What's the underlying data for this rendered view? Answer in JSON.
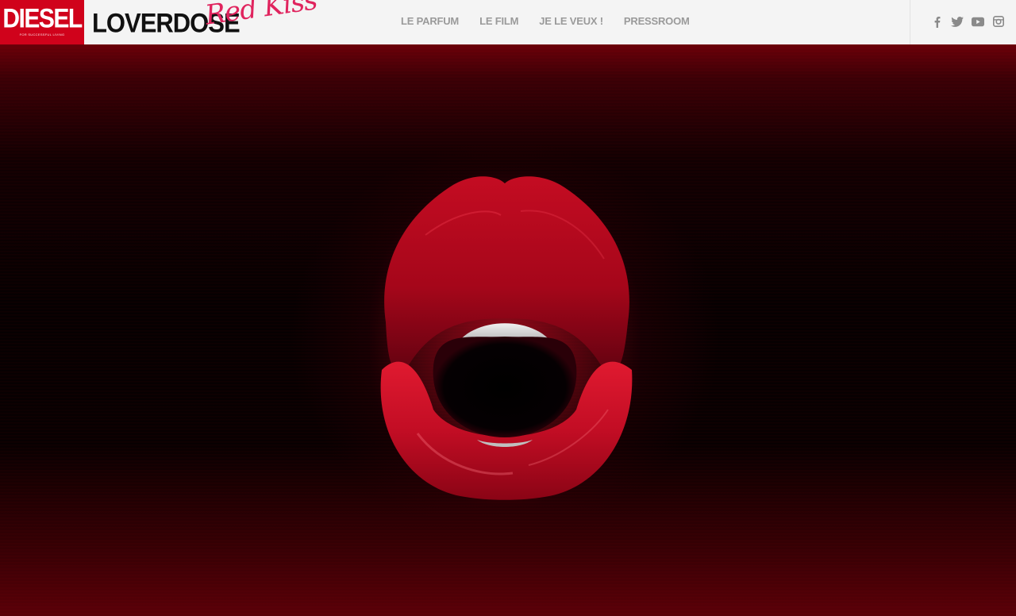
{
  "brand": {
    "diesel": "DIESEL",
    "diesel_tagline": "FOR SUCCESSFUL LIVING",
    "loverdose": "LOVERDOSE",
    "redkiss": "Red Kiss",
    "accent_red": "#d0021b",
    "accent_pink": "#e0245e"
  },
  "nav": {
    "items": [
      {
        "label": "LE PARFUM"
      },
      {
        "label": "LE FILM"
      },
      {
        "label": "JE LE VEUX !"
      },
      {
        "label": "PRESSROOM"
      }
    ]
  },
  "social": {
    "icons": [
      "facebook-icon",
      "twitter-icon",
      "youtube-icon",
      "instagram-icon"
    ]
  },
  "hero": {
    "image": "red-lips-visual"
  }
}
